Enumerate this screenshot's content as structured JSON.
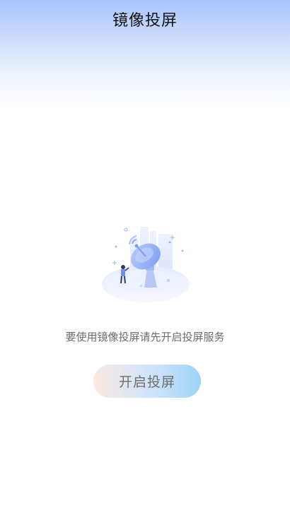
{
  "header": {
    "title": "镜像投屏"
  },
  "main": {
    "prompt": "要使用镜像投屏请先开启投屏服务",
    "start_button_label": "开启投屏"
  },
  "colors": {
    "header_gradient_top": "#a9c4fb",
    "accent_blue": "#7b9cf0",
    "button_gradient_start": "#fbe9e1",
    "button_gradient_end": "#9dd3f7"
  }
}
